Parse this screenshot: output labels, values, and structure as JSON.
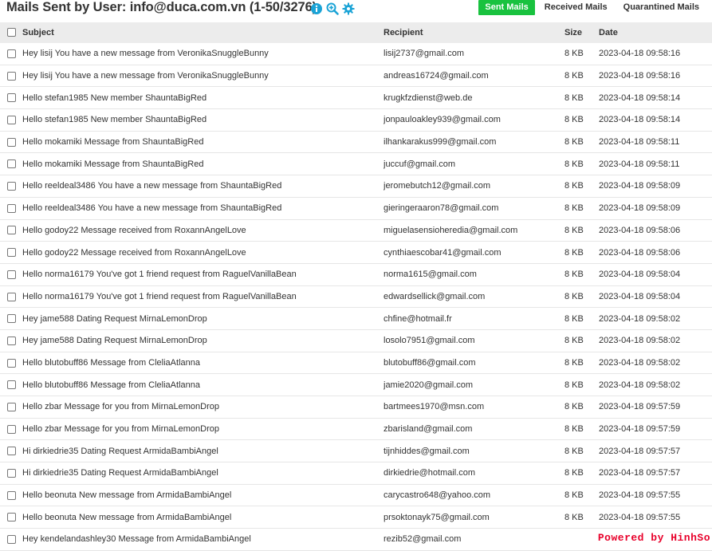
{
  "header": {
    "title": "Mails Sent by User: info@duca.com.vn (1-50/3276)",
    "icons": [
      "info-icon",
      "zoom-icon",
      "gear-icon"
    ],
    "accent_color": "#1aa3d6"
  },
  "tabs": [
    {
      "label": "Sent Mails",
      "active": true
    },
    {
      "label": "Received Mails",
      "active": false
    },
    {
      "label": "Quarantined Mails",
      "active": false
    }
  ],
  "colors": {
    "active_tab": "#19c23f",
    "header_bg": "#ececec",
    "footer_text": "#e8002a"
  },
  "table": {
    "columns": {
      "subject": "Subject",
      "recipient": "Recipient",
      "size": "Size",
      "date": "Date"
    },
    "rows": [
      {
        "subject": "Hey lisij You have a new message from VeronikaSnuggleBunny",
        "recipient": "lisij2737@gmail.com",
        "size": "8 KB",
        "date": "2023-04-18 09:58:16"
      },
      {
        "subject": "Hey lisij You have a new message from VeronikaSnuggleBunny",
        "recipient": "andreas16724@gmail.com",
        "size": "8 KB",
        "date": "2023-04-18 09:58:16"
      },
      {
        "subject": "Hello stefan1985 New member ShauntaBigRed",
        "recipient": "krugkfzdienst@web.de",
        "size": "8 KB",
        "date": "2023-04-18 09:58:14"
      },
      {
        "subject": "Hello stefan1985 New member ShauntaBigRed",
        "recipient": "jonpauloakley939@gmail.com",
        "size": "8 KB",
        "date": "2023-04-18 09:58:14"
      },
      {
        "subject": "Hello mokamiki Message from ShauntaBigRed",
        "recipient": "ilhankarakus999@gmail.com",
        "size": "8 KB",
        "date": "2023-04-18 09:58:11"
      },
      {
        "subject": "Hello mokamiki Message from ShauntaBigRed",
        "recipient": "juccuf@gmail.com",
        "size": "8 KB",
        "date": "2023-04-18 09:58:11"
      },
      {
        "subject": "Hello reeldeal3486 You have a new message from ShauntaBigRed",
        "recipient": "jeromebutch12@gmail.com",
        "size": "8 KB",
        "date": "2023-04-18 09:58:09"
      },
      {
        "subject": "Hello reeldeal3486 You have a new message from ShauntaBigRed",
        "recipient": "gieringeraaron78@gmail.com",
        "size": "8 KB",
        "date": "2023-04-18 09:58:09"
      },
      {
        "subject": "Hello godoy22 Message received from RoxannAngelLove",
        "recipient": "miguelasensioheredia@gmail.com",
        "size": "8 KB",
        "date": "2023-04-18 09:58:06"
      },
      {
        "subject": "Hello godoy22 Message received from RoxannAngelLove",
        "recipient": "cynthiaescobar41@gmail.com",
        "size": "8 KB",
        "date": "2023-04-18 09:58:06"
      },
      {
        "subject": "Hello norma16179 You've got 1 friend request from RaguelVanillaBean",
        "recipient": "norma1615@gmail.com",
        "size": "8 KB",
        "date": "2023-04-18 09:58:04"
      },
      {
        "subject": "Hello norma16179 You've got 1 friend request from RaguelVanillaBean",
        "recipient": "edwardsellick@gmail.com",
        "size": "8 KB",
        "date": "2023-04-18 09:58:04"
      },
      {
        "subject": "Hey jame588 Dating Request MirnaLemonDrop",
        "recipient": "chfine@hotmail.fr",
        "size": "8 KB",
        "date": "2023-04-18 09:58:02"
      },
      {
        "subject": "Hey jame588 Dating Request MirnaLemonDrop",
        "recipient": "losolo7951@gmail.com",
        "size": "8 KB",
        "date": "2023-04-18 09:58:02"
      },
      {
        "subject": "Hello blutobuff86 Message from CleliaAtlanna",
        "recipient": "blutobuff86@gmail.com",
        "size": "8 KB",
        "date": "2023-04-18 09:58:02"
      },
      {
        "subject": "Hello blutobuff86 Message from CleliaAtlanna",
        "recipient": "jamie2020@gmail.com",
        "size": "8 KB",
        "date": "2023-04-18 09:58:02"
      },
      {
        "subject": "Hello zbar Message for you from MirnaLemonDrop",
        "recipient": "bartmees1970@msn.com",
        "size": "8 KB",
        "date": "2023-04-18 09:57:59"
      },
      {
        "subject": "Hello zbar Message for you from MirnaLemonDrop",
        "recipient": "zbarisland@gmail.com",
        "size": "8 KB",
        "date": "2023-04-18 09:57:59"
      },
      {
        "subject": "Hi dirkiedrie35 Dating Request ArmidaBambiAngel",
        "recipient": "tijnhiddes@gmail.com",
        "size": "8 KB",
        "date": "2023-04-18 09:57:57"
      },
      {
        "subject": "Hi dirkiedrie35 Dating Request ArmidaBambiAngel",
        "recipient": "dirkiedrie@hotmail.com",
        "size": "8 KB",
        "date": "2023-04-18 09:57:57"
      },
      {
        "subject": "Hello beonuta New message from ArmidaBambiAngel",
        "recipient": "carycastro648@yahoo.com",
        "size": "8 KB",
        "date": "2023-04-18 09:57:55"
      },
      {
        "subject": "Hello beonuta New message from ArmidaBambiAngel",
        "recipient": "prsoktonayk75@gmail.com",
        "size": "8 KB",
        "date": "2023-04-18 09:57:55"
      },
      {
        "subject": "Hey kendelandashley30 Message from ArmidaBambiAngel",
        "recipient": "rezib52@gmail.com",
        "size": "",
        "date": ""
      }
    ]
  },
  "footer": {
    "powered": "Powered by HinhSo"
  }
}
